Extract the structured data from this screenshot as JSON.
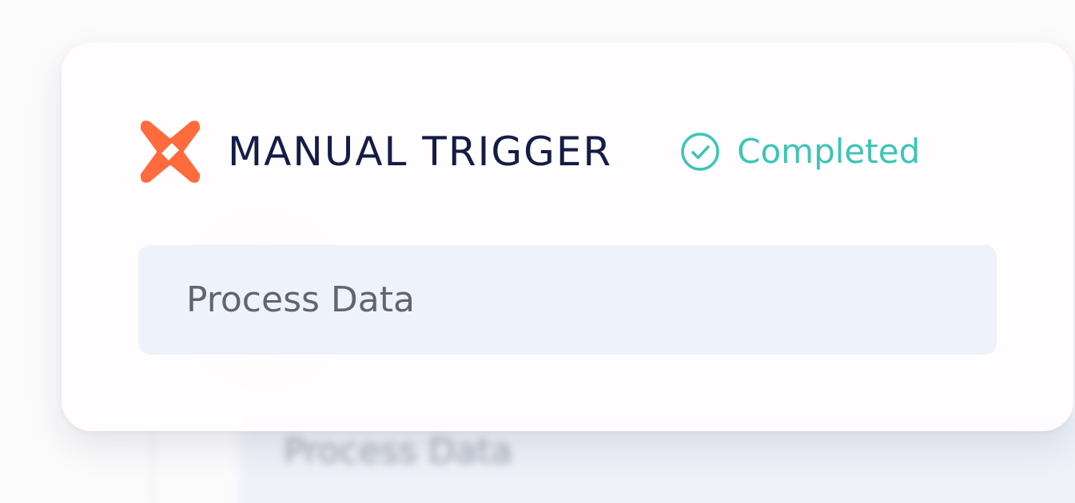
{
  "background": {
    "task_label": "Process Data"
  },
  "card": {
    "logo_icon": "dbt-logo-icon",
    "title": "MANUAL TRIGGER",
    "status": {
      "icon": "check-circle-icon",
      "label": "Completed",
      "color": "#3cc5b5"
    },
    "task": {
      "label": "Process Data"
    }
  },
  "colors": {
    "brand": "#ff6b3d",
    "title": "#141c47",
    "success": "#3cc5b5",
    "task_background": "#eef2fa"
  }
}
